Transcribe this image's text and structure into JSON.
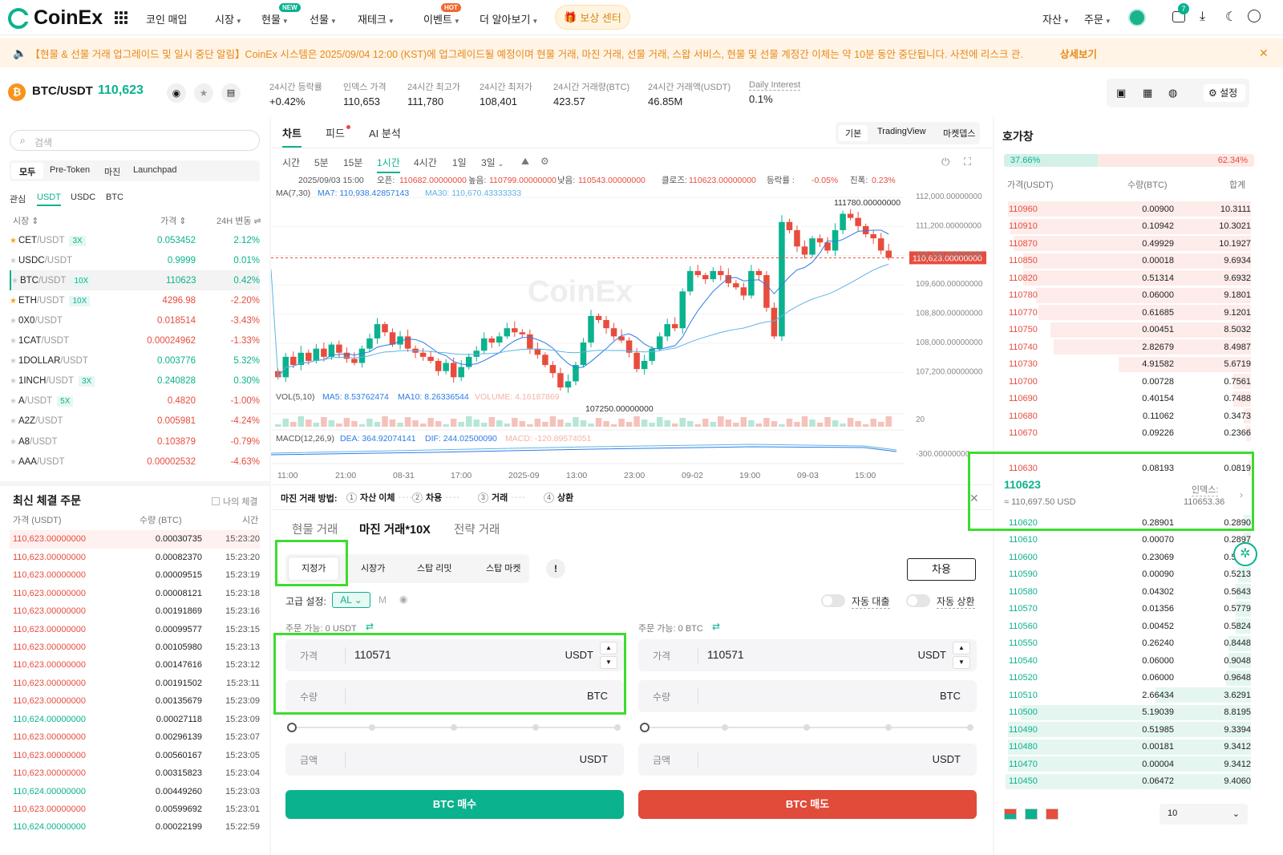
{
  "header": {
    "logo": "CoinEx",
    "nav": [
      {
        "label": "코인 매입",
        "x": 182
      },
      {
        "label": "시장",
        "x": 268,
        "caret": true
      },
      {
        "label": "현물",
        "x": 326,
        "caret": true,
        "badge": "NEW"
      },
      {
        "label": "선물",
        "x": 386,
        "caret": true
      },
      {
        "label": "재테크",
        "x": 446,
        "caret": true
      },
      {
        "label": "이벤트",
        "x": 528,
        "caret": true,
        "badge": "HOT"
      },
      {
        "label": "더 알아보기",
        "x": 598,
        "caret": true
      }
    ],
    "reward": "보상 센터",
    "right": {
      "assets": "자산",
      "orders": "주문",
      "notif_count": "7"
    },
    "colors": {
      "brand": "#0bb28e",
      "sell": "#e84c3d",
      "buy": "#0bb28e"
    }
  },
  "notice": {
    "text": "【현물 & 선물 거래 업그레이드 및 일시 중단 알림】CoinEx 시스템은 2025/09/04 12:00 (KST)에 업그레이드될 예정이며 현물 거래, 마진 거래, 선물 거래, 스왑 서비스, 현물 및 선물 계정간 이체는 약 10분 동안 중단됩니다. 사전에 리스크 관...",
    "more": "상세보기"
  },
  "pair": {
    "symbol": "BTC/USDT",
    "price": "110,623",
    "stats": [
      {
        "label": "24시간 등락률",
        "value": "+0.42%",
        "green": true
      },
      {
        "label": "인덱스 가격",
        "value": "110,653"
      },
      {
        "label": "24시간 최고가",
        "value": "111,780"
      },
      {
        "label": "24시간 최저가",
        "value": "108,401"
      },
      {
        "label": "24시간 거래량(BTC)",
        "value": "423.57"
      },
      {
        "label": "24시간 거래액(USDT)",
        "value": "46.85M"
      },
      {
        "label": "Daily Interest",
        "value": "0.1%"
      }
    ],
    "settings": "설정"
  },
  "markets": {
    "search_placeholder": "검색",
    "tabs": [
      "모두",
      "Pre-Token",
      "마진",
      "Launchpad"
    ],
    "quote_tabs": [
      "관심",
      "USDT",
      "USDC",
      "BTC"
    ],
    "headers": {
      "market": "시장",
      "price": "가격",
      "change": "24H 변동"
    },
    "rows": [
      {
        "base": "CET",
        "quote": "/USDT",
        "lev": "3X",
        "price": "0.053452",
        "change": "2.12%",
        "up": true,
        "star": true
      },
      {
        "base": "USDC",
        "quote": "/USDT",
        "lev": "",
        "price": "0.9999",
        "change": "0.01%",
        "up": true,
        "star": false
      },
      {
        "base": "BTC",
        "quote": "/USDT",
        "lev": "10X",
        "price": "110623",
        "change": "0.42%",
        "up": true,
        "star": false
      },
      {
        "base": "ETH",
        "quote": "/USDT",
        "lev": "10X",
        "price": "4296.98",
        "change": "-2.20%",
        "up": false,
        "star": true
      },
      {
        "base": "0X0",
        "quote": "/USDT",
        "lev": "",
        "price": "0.018514",
        "change": "-3.43%",
        "up": false,
        "star": false
      },
      {
        "base": "1CAT",
        "quote": "/USDT",
        "lev": "",
        "price": "0.00024962",
        "change": "-1.33%",
        "up": false,
        "star": false
      },
      {
        "base": "1DOLLAR",
        "quote": "/USDT",
        "lev": "",
        "price": "0.003776",
        "change": "5.32%",
        "up": true,
        "star": false
      },
      {
        "base": "1INCH",
        "quote": "/USDT",
        "lev": "3X",
        "price": "0.240828",
        "change": "0.30%",
        "up": true,
        "star": false
      },
      {
        "base": "A",
        "quote": "/USDT",
        "lev": "5X",
        "price": "0.4820",
        "change": "-1.00%",
        "up": false,
        "star": false
      },
      {
        "base": "A2Z",
        "quote": "/USDT",
        "lev": "",
        "price": "0.005981",
        "change": "-4.24%",
        "up": false,
        "star": false
      },
      {
        "base": "A8",
        "quote": "/USDT",
        "lev": "",
        "price": "0.103879",
        "change": "-0.79%",
        "up": false,
        "star": false
      },
      {
        "base": "AAA",
        "quote": "/USDT",
        "lev": "",
        "price": "0.00002532",
        "change": "-4.63%",
        "up": false,
        "star": false
      }
    ]
  },
  "trades": {
    "title": "최신 체결 주문",
    "mine": "나의 체결",
    "headers": {
      "price": "가격 (USDT)",
      "qty": "수량 (BTC)",
      "time": "시간"
    },
    "rows": [
      {
        "p": "110,623.00000000",
        "q": "0.00030735",
        "t": "15:23:20",
        "up": false
      },
      {
        "p": "110,623.00000000",
        "q": "0.00082370",
        "t": "15:23:20",
        "up": false
      },
      {
        "p": "110,623.00000000",
        "q": "0.00009515",
        "t": "15:23:19",
        "up": false
      },
      {
        "p": "110,623.00000000",
        "q": "0.00008121",
        "t": "15:23:18",
        "up": false
      },
      {
        "p": "110,623.00000000",
        "q": "0.00191869",
        "t": "15:23:16",
        "up": false
      },
      {
        "p": "110,623.00000000",
        "q": "0.00099577",
        "t": "15:23:15",
        "up": false
      },
      {
        "p": "110,623.00000000",
        "q": "0.00105980",
        "t": "15:23:13",
        "up": false
      },
      {
        "p": "110,623.00000000",
        "q": "0.00147616",
        "t": "15:23:12",
        "up": false
      },
      {
        "p": "110,623.00000000",
        "q": "0.00191502",
        "t": "15:23:11",
        "up": false
      },
      {
        "p": "110,623.00000000",
        "q": "0.00135679",
        "t": "15:23:09",
        "up": false
      },
      {
        "p": "110,624.00000000",
        "q": "0.00027118",
        "t": "15:23:09",
        "up": true
      },
      {
        "p": "110,623.00000000",
        "q": "0.00296139",
        "t": "15:23:07",
        "up": false
      },
      {
        "p": "110,623.00000000",
        "q": "0.00560167",
        "t": "15:23:05",
        "up": false
      },
      {
        "p": "110,623.00000000",
        "q": "0.00315823",
        "t": "15:23:04",
        "up": false
      },
      {
        "p": "110,624.00000000",
        "q": "0.00449260",
        "t": "15:23:03",
        "up": true
      },
      {
        "p": "110,623.00000000",
        "q": "0.00599692",
        "t": "15:23:01",
        "up": false
      },
      {
        "p": "110,624.00000000",
        "q": "0.00022199",
        "t": "15:22:59",
        "up": true
      }
    ]
  },
  "chart": {
    "tabs": [
      "차트",
      "피드",
      "AI 분석"
    ],
    "views": [
      "기본",
      "TradingView",
      "마켓뎁스"
    ],
    "intervals": [
      "시간",
      "5분",
      "15분",
      "1시간",
      "4시간",
      "1일",
      "3일"
    ],
    "active_interval": "1시간",
    "ohlc_line": {
      "date": "2025/09/03 15:00",
      "open_label": "오픈:",
      "open": "110682.00000000",
      "high_label": "높음:",
      "high": "110799.00000000",
      "low_label": "낮음:",
      "low": "110543.00000000",
      "close_label": "클로즈:",
      "close": "110623.00000000",
      "chg_label": "등락률 :",
      "chg": "-0.05%",
      "amp_label": "진폭:",
      "amp": "0.23%"
    },
    "ma_line": {
      "label": "MA(7,30)",
      "ma7": "MA7: 110,938.42857143",
      "ma30": "MA30: 110,670.43333333"
    },
    "vol_line": {
      "label": "VOL(5,10)",
      "ma5": "MA5: 8.53762474",
      "ma10": "MA10: 8.26336544",
      "volume": "VOLUME: 4.16187869"
    },
    "macd_line": {
      "label": "MACD(12,26,9)",
      "dea": "DEA: 364.92074141",
      "dif": "DIF: 244.02500090",
      "macd": "MACD: -120.89574051"
    },
    "high_mark": "111780.00000000",
    "low_mark": "107250.00000000",
    "last_price_label": "110,623.00000000",
    "y_ticks": [
      "112,000.00000000",
      "111,200.00000000",
      "110,400.00000000",
      "109,600.00000000",
      "108,800.00000000",
      "108,000.00000000",
      "107,200.00000000"
    ],
    "vol_tick": "20",
    "macd_tick": "-300.00000000",
    "x_ticks": [
      "11:00",
      "21:00",
      "08-31",
      "17:00",
      "2025-09",
      "13:00",
      "23:00",
      "09-02",
      "19:00",
      "09-03",
      "15:00"
    ],
    "watermark": "CoinEx"
  },
  "chart_data": {
    "type": "candlestick",
    "y_range": [
      107000,
      112300
    ],
    "closes": [
      107700,
      108200,
      108000,
      108300,
      108100,
      108400,
      108200,
      108500,
      108300,
      108150,
      108050,
      108400,
      108650,
      109000,
      108800,
      108500,
      108700,
      108400,
      108300,
      108200,
      108100,
      107850,
      108050,
      107700,
      107950,
      108200,
      108350,
      108650,
      108550,
      108700,
      108900,
      108800,
      108750,
      108400,
      108250,
      108000,
      107800,
      107450,
      107600,
      108000,
      108550,
      109200,
      109100,
      108900,
      108700,
      108600,
      108300,
      107900,
      108100,
      108400,
      108700,
      109000,
      108900,
      109800,
      110300,
      110200,
      110100,
      110300,
      110200,
      110000,
      109900,
      109700,
      110300,
      110200,
      109400,
      108700,
      111500,
      111300,
      110900,
      110700,
      111100,
      111000,
      110800,
      111300,
      111700,
      111600,
      111400,
      111200,
      111100,
      110800,
      110623
    ]
  },
  "order": {
    "steps_title": "마진 거래 방법:",
    "steps": [
      "자산 이체",
      "차용",
      "거래",
      "상환"
    ],
    "modes": [
      "현물 거래",
      "마진 거래*10X",
      "전략 거래"
    ],
    "types": [
      "지정가",
      "시장가",
      "스탑 리밋",
      "스탑 마켓"
    ],
    "borrow": "차용",
    "advanced": "고급 설정:",
    "al": "AL",
    "m": "M",
    "auto_borrow": "자동 대출",
    "auto_repay": "자동 상환",
    "buy": {
      "avail": "주문 가능: 0 USDT",
      "price_label": "가격",
      "price": "110571",
      "price_unit": "USDT",
      "qty_label": "수량",
      "qty_unit": "BTC",
      "amount_label": "금액",
      "amount_unit": "USDT",
      "button": "BTC 매수"
    },
    "sell": {
      "avail": "주문 가능: 0 BTC",
      "price_label": "가격",
      "price": "110571",
      "price_unit": "USDT",
      "qty_label": "수량",
      "qty_unit": "BTC",
      "amount_label": "금액",
      "amount_unit": "USDT",
      "button": "BTC 매도"
    }
  },
  "orderbook": {
    "title": "호가창",
    "buy_pct": "37.66%",
    "sell_pct": "62.34%",
    "buy_ratio": 0.3766,
    "headers": {
      "price": "가격(USDT)",
      "qty": "수량(BTC)",
      "total": "합계"
    },
    "asks": [
      {
        "p": "110960",
        "q": "0.00900",
        "t": "10.3111",
        "d": 0.97
      },
      {
        "p": "110910",
        "q": "0.10942",
        "t": "10.3021",
        "d": 0.96
      },
      {
        "p": "110870",
        "q": "0.49929",
        "t": "10.1927",
        "d": 0.95
      },
      {
        "p": "110850",
        "q": "0.00018",
        "t": "9.6934",
        "d": 0.91
      },
      {
        "p": "110820",
        "q": "0.51314",
        "t": "9.6932",
        "d": 0.91
      },
      {
        "p": "110780",
        "q": "0.06000",
        "t": "9.1801",
        "d": 0.86
      },
      {
        "p": "110770",
        "q": "0.61685",
        "t": "9.1201",
        "d": 0.85
      },
      {
        "p": "110750",
        "q": "0.00451",
        "t": "8.5032",
        "d": 0.8
      },
      {
        "p": "110740",
        "q": "2.82679",
        "t": "8.4987",
        "d": 0.79
      },
      {
        "p": "110730",
        "q": "4.91582",
        "t": "5.6719",
        "d": 0.53
      },
      {
        "p": "110700",
        "q": "0.00728",
        "t": "0.7561",
        "d": 0.07
      },
      {
        "p": "110690",
        "q": "0.40154",
        "t": "0.7488",
        "d": 0.07
      },
      {
        "p": "110680",
        "q": "0.11062",
        "t": "0.3473",
        "d": 0.03
      },
      {
        "p": "110670",
        "q": "0.09226",
        "t": "0.2366",
        "d": 0.02
      },
      {
        "p": "110630",
        "q": "0.08193",
        "t": "0.0819",
        "d": 0.01
      }
    ],
    "mid": {
      "price": "110623",
      "usd": "≈ 110,697.50  USD",
      "index_label": "인덱스:",
      "index": "110653.36"
    },
    "bids": [
      {
        "p": "110620",
        "q": "0.28901",
        "t": "0.2890",
        "d": 0.03
      },
      {
        "p": "110610",
        "q": "0.00070",
        "t": "0.2897",
        "d": 0.03
      },
      {
        "p": "110600",
        "q": "0.23069",
        "t": "0.5204",
        "d": 0.05
      },
      {
        "p": "110590",
        "q": "0.00090",
        "t": "0.5213",
        "d": 0.05
      },
      {
        "p": "110580",
        "q": "0.04302",
        "t": "0.5643",
        "d": 0.06
      },
      {
        "p": "110570",
        "q": "0.01356",
        "t": "0.5779",
        "d": 0.06
      },
      {
        "p": "110560",
        "q": "0.00452",
        "t": "0.5824",
        "d": 0.06
      },
      {
        "p": "110550",
        "q": "0.26240",
        "t": "0.8448",
        "d": 0.09
      },
      {
        "p": "110540",
        "q": "0.06000",
        "t": "0.9048",
        "d": 0.09
      },
      {
        "p": "110520",
        "q": "0.06000",
        "t": "0.9648",
        "d": 0.1
      },
      {
        "p": "110510",
        "q": "2.66434",
        "t": "3.6291",
        "d": 0.38
      },
      {
        "p": "110500",
        "q": "5.19039",
        "t": "8.8195",
        "d": 0.92
      },
      {
        "p": "110490",
        "q": "0.51985",
        "t": "9.3394",
        "d": 0.97
      },
      {
        "p": "110480",
        "q": "0.00181",
        "t": "9.3412",
        "d": 0.97
      },
      {
        "p": "110470",
        "q": "0.00004",
        "t": "9.3412",
        "d": 0.97
      },
      {
        "p": "110450",
        "q": "0.06472",
        "t": "9.4060",
        "d": 0.98
      }
    ],
    "precision": "10"
  }
}
